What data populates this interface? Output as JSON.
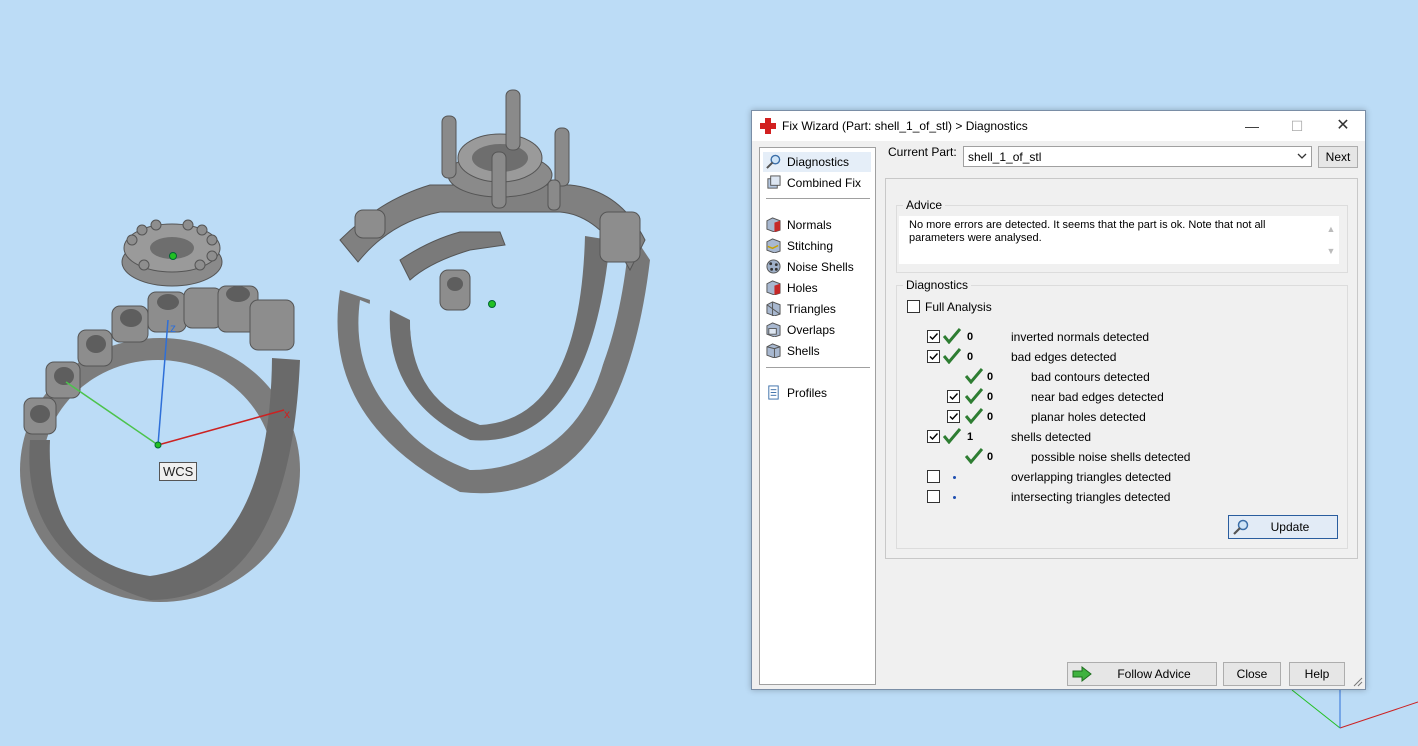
{
  "viewport": {
    "wcs_label": "WCS",
    "axis_x_label": "x",
    "axis_z_label": "z",
    "background_color": "#bcdcf6"
  },
  "dialog": {
    "title": "Fix Wizard (Part: shell_1_of_stl) > Diagnostics",
    "title_icon": "red-cross-icon",
    "window_buttons": {
      "minimize": "—",
      "maximize": "☐",
      "close": "✕"
    },
    "nav": {
      "items": [
        {
          "label": "Diagnostics",
          "icon": "magnifier-icon",
          "selected": true
        },
        {
          "label": "Combined Fix",
          "icon": "combined-fix-icon"
        },
        {
          "label": "Normals",
          "icon": "normals-icon"
        },
        {
          "label": "Stitching",
          "icon": "stitching-icon"
        },
        {
          "label": "Noise Shells",
          "icon": "noise-shells-icon"
        },
        {
          "label": "Holes",
          "icon": "holes-icon"
        },
        {
          "label": "Triangles",
          "icon": "triangles-icon"
        },
        {
          "label": "Overlaps",
          "icon": "overlaps-icon"
        },
        {
          "label": "Shells",
          "icon": "shells-icon"
        },
        {
          "label": "Profiles",
          "icon": "profiles-icon"
        }
      ]
    },
    "current_part": {
      "label": "Current Part:",
      "value": "shell_1_of_stl",
      "next_label": "Next"
    },
    "advice": {
      "title": "Advice",
      "text": "No more errors are detected. It seems that the part is ok. Note that not all parameters were analysed."
    },
    "diagnostics": {
      "title": "Diagnostics",
      "full_analysis_label": "Full Analysis",
      "full_analysis_checked": false,
      "rows": [
        {
          "checked": true,
          "status": "ok",
          "count": "0",
          "label": "inverted normals detected"
        },
        {
          "checked": true,
          "status": "ok",
          "count": "0",
          "label": "bad edges detected"
        },
        {
          "status": "ok",
          "count": "0",
          "label": "bad contours detected"
        },
        {
          "checked": true,
          "status": "ok",
          "count": "0",
          "label": "near bad edges detected"
        },
        {
          "checked": true,
          "status": "ok",
          "count": "0",
          "label": "planar holes detected"
        },
        {
          "checked": true,
          "status": "ok",
          "count": "1",
          "label": "shells detected"
        },
        {
          "status": "ok",
          "count": "0",
          "label": "possible noise shells detected"
        },
        {
          "checked": false,
          "status": "not-analysed",
          "count": "",
          "label": "overlapping triangles detected"
        },
        {
          "checked": false,
          "status": "not-analysed",
          "count": "",
          "label": "intersecting triangles detected"
        }
      ],
      "update_label": "Update"
    },
    "footer": {
      "follow_advice": "Follow Advice",
      "close": "Close",
      "help": "Help"
    },
    "colors": {
      "ok_tick": "#2e7d32",
      "update_border": "#2a5d9e",
      "title_icon": "#d22020"
    }
  }
}
